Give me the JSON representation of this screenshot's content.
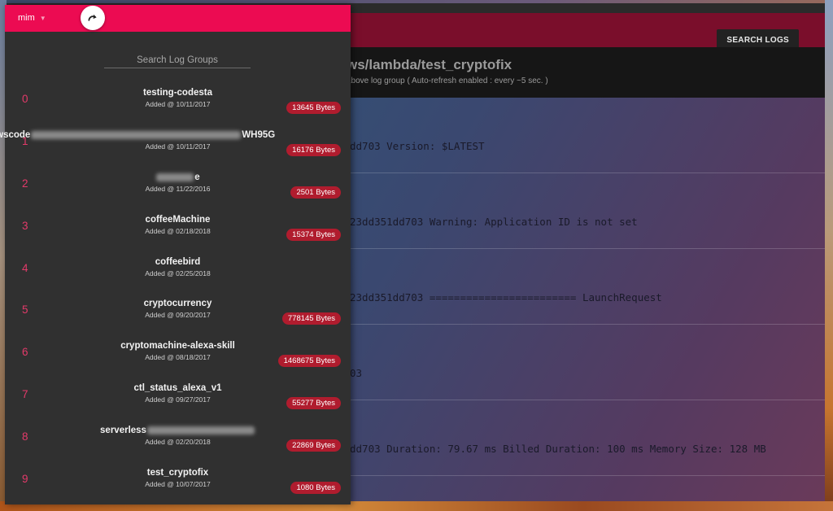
{
  "header": {
    "search_logs_label": "SEARCH LOGS"
  },
  "log_view": {
    "title": "ws/lambda/test_cryptofix",
    "subtitle": "above log group ( Auto-refresh enabled : every ~5 sec. )",
    "lines": [
      "dd703 Version: $LATEST",
      "23dd351dd703 Warning: Application ID is not set",
      "23dd351dd703 ======================== LaunchRequest",
      "03",
      "dd703 Duration: 79.67 ms Billed Duration: 100 ms Memory Size: 128 MB"
    ]
  },
  "drawer": {
    "account": "mim",
    "search_placeholder": "Search Log Groups",
    "groups": [
      {
        "index": "0",
        "name": "testing-codesta",
        "added": "Added @ 10/11/2017",
        "size": "13645 Bytes"
      },
      {
        "index": "1",
        "name_prefix": "awscode",
        "name_suffix": "WH95G",
        "added": "Added @ 10/11/2017",
        "size": "16176 Bytes"
      },
      {
        "index": "2",
        "name_suffix": "e",
        "added": "Added @ 11/22/2016",
        "size": "2501 Bytes"
      },
      {
        "index": "3",
        "name": "coffeeMachine",
        "added": "Added @ 02/18/2018",
        "size": "15374 Bytes"
      },
      {
        "index": "4",
        "name": "coffeebird",
        "added": "Added @ 02/25/2018",
        "size": ""
      },
      {
        "index": "5",
        "name": "cryptocurrency",
        "added": "Added @ 09/20/2017",
        "size": "778145 Bytes"
      },
      {
        "index": "6",
        "name": "cryptomachine-alexa-skill",
        "added": "Added @ 08/18/2017",
        "size": "1468675 Bytes"
      },
      {
        "index": "7",
        "name": "ctl_status_alexa_v1",
        "added": "Added @ 09/27/2017",
        "size": "55277 Bytes"
      },
      {
        "index": "8",
        "name_prefix": "serverless",
        "added": "Added @ 02/20/2018",
        "size": "22869 Bytes"
      },
      {
        "index": "9",
        "name": "test_cryptofix",
        "added": "Added @ 10/07/2017",
        "size": "1080 Bytes"
      }
    ]
  },
  "colors": {
    "accent": "#ec0b52",
    "header_dark": "#7a0e2b",
    "badge": "#b01c2e",
    "index": "#e33a6a"
  },
  "icons": {
    "refresh": "redo-arrow-icon",
    "caret": "caret-down-icon"
  }
}
